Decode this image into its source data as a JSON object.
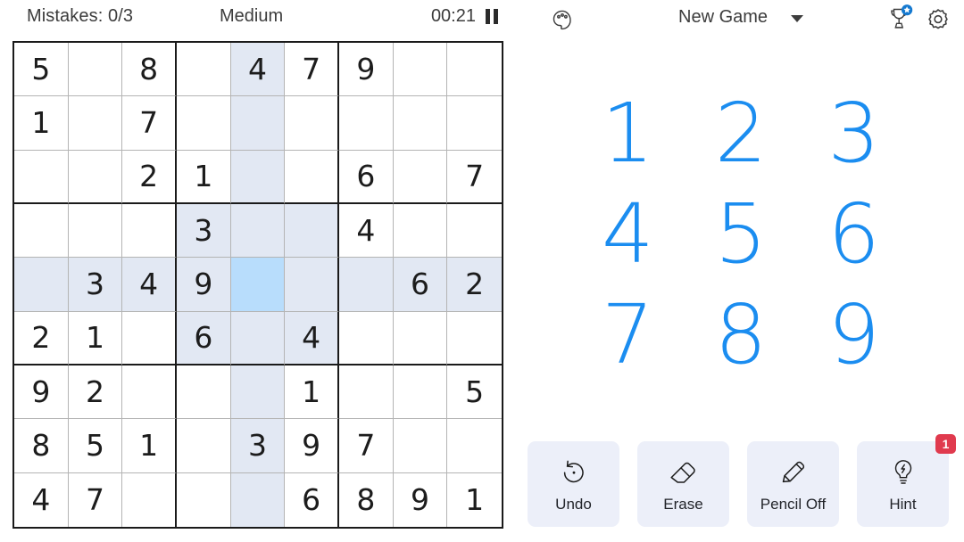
{
  "status": {
    "mistakes_label": "Mistakes: 0/3",
    "difficulty": "Medium",
    "timer": "00:21",
    "pause_icon": "pause-icon"
  },
  "header": {
    "palette_icon": "palette-icon",
    "new_game_label": "New Game",
    "caret_icon": "chevron-down-icon",
    "trophy_icon": "trophy-icon",
    "gear_icon": "gear-icon"
  },
  "board": {
    "selected": {
      "row": 4,
      "col": 4
    },
    "highlight_color": "#e2e8f3",
    "selected_color": "#b8ddfc",
    "rows": [
      [
        "5",
        "",
        "8",
        "",
        "4",
        "7",
        "9",
        "",
        ""
      ],
      [
        "1",
        "",
        "7",
        "",
        "",
        "",
        "",
        "",
        ""
      ],
      [
        "",
        "",
        "2",
        "1",
        "",
        "",
        "6",
        "",
        "7"
      ],
      [
        "",
        "",
        "",
        "3",
        "",
        "",
        "4",
        "",
        ""
      ],
      [
        "",
        "3",
        "4",
        "9",
        "",
        "",
        "",
        "6",
        "2"
      ],
      [
        "2",
        "1",
        "",
        "6",
        "",
        "4",
        "",
        "",
        ""
      ],
      [
        "9",
        "2",
        "",
        "",
        "",
        "1",
        "",
        "",
        "5"
      ],
      [
        "8",
        "5",
        "1",
        "",
        "3",
        "9",
        "7",
        "",
        ""
      ],
      [
        "4",
        "7",
        "",
        "",
        "",
        "6",
        "8",
        "9",
        "1"
      ]
    ]
  },
  "numpad": {
    "color": "#1b8df0",
    "digits": [
      "1",
      "2",
      "3",
      "4",
      "5",
      "6",
      "7",
      "8",
      "9"
    ]
  },
  "actions": [
    {
      "label": "Undo",
      "icon": "undo-icon",
      "badge": ""
    },
    {
      "label": "Erase",
      "icon": "eraser-icon",
      "badge": ""
    },
    {
      "label": "Pencil Off",
      "icon": "pencil-icon",
      "badge": ""
    },
    {
      "label": "Hint",
      "icon": "bulb-icon",
      "badge": "1"
    }
  ]
}
